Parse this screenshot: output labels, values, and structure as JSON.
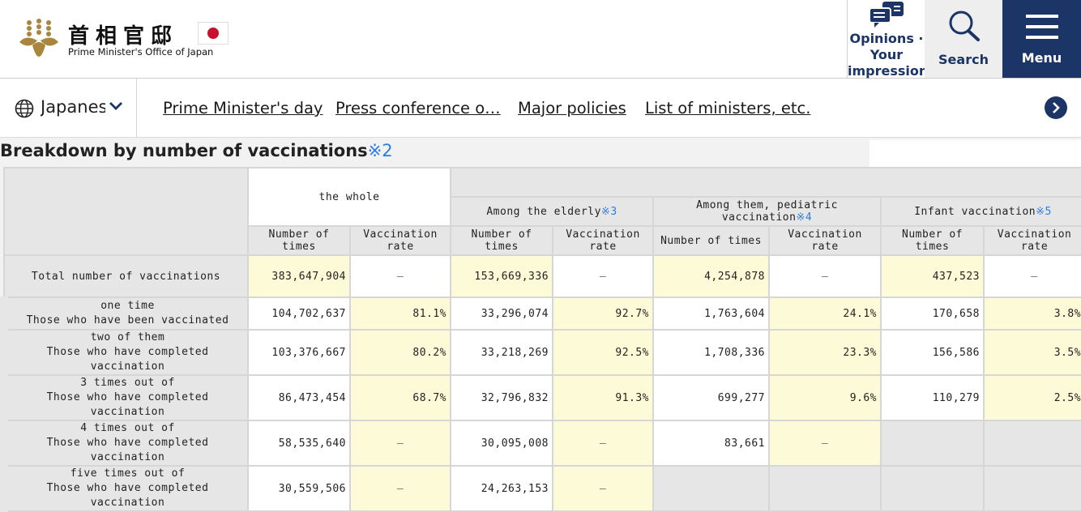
{
  "header": {
    "title_jp": "首相官邸",
    "title_en": "Prime Minister's Office of Japan",
    "opinions_label": "Opinions · Your impression",
    "search_label": "Search",
    "menu_label": "Menu"
  },
  "nav": {
    "language": "Japanese",
    "links": [
      "Prime Minister's day",
      "Press conference o…",
      "Major policies",
      "List of ministers, etc."
    ]
  },
  "section": {
    "title": "Breakdown by number of vaccinations",
    "title_note": "※2"
  },
  "table": {
    "group_whole": "the whole",
    "group_elderly": "Among the elderly",
    "group_elderly_note": "※3",
    "group_pediatric": "Among them, pediatric vaccination",
    "group_pediatric_note": "※4",
    "group_infant": "Infant vaccination",
    "group_infant_note": "※5",
    "col_times": "Number of times",
    "col_rate": "Vaccination rate",
    "dash": "—",
    "total": {
      "label": "Total number of vaccinations",
      "whole": "383,647,904",
      "elderly": "153,669,336",
      "pediatric": "4,254,878",
      "infant": "437,523"
    },
    "rows": [
      {
        "label1": "one time",
        "label2": "Those who have been vaccinated",
        "whole": "104,702,637",
        "whole_rate": "81.1%",
        "elderly": "33,296,074",
        "elderly_rate": "92.7%",
        "pediatric": "1,763,604",
        "pediatric_rate": "24.1%",
        "infant": "170,658",
        "infant_rate": "3.8%"
      },
      {
        "label1": "two of them",
        "label2": "Those who have completed vaccination",
        "whole": "103,376,667",
        "whole_rate": "80.2%",
        "elderly": "33,218,269",
        "elderly_rate": "92.5%",
        "pediatric": "1,708,336",
        "pediatric_rate": "23.3%",
        "infant": "156,586",
        "infant_rate": "3.5%"
      },
      {
        "label1": "3 times out of",
        "label2": "Those who have completed vaccination",
        "whole": "86,473,454",
        "whole_rate": "68.7%",
        "elderly": "32,796,832",
        "elderly_rate": "91.3%",
        "pediatric": "699,277",
        "pediatric_rate": "9.6%",
        "infant": "110,279",
        "infant_rate": "2.5%"
      },
      {
        "label1": "4 times out of",
        "label2": "Those who have completed vaccination",
        "whole": "58,535,640",
        "elderly": "30,095,008",
        "pediatric": "83,661"
      },
      {
        "label1": "five times out of",
        "label2": "Those who have completed vaccination",
        "whole": "30,559,506",
        "elderly": "24,263,153"
      }
    ]
  },
  "colors": {
    "brand_navy": "#1a3566",
    "note_blue": "#2a7de1",
    "highlight_yellow": "#fdfbd7",
    "cell_gray": "#e6e6e6"
  }
}
